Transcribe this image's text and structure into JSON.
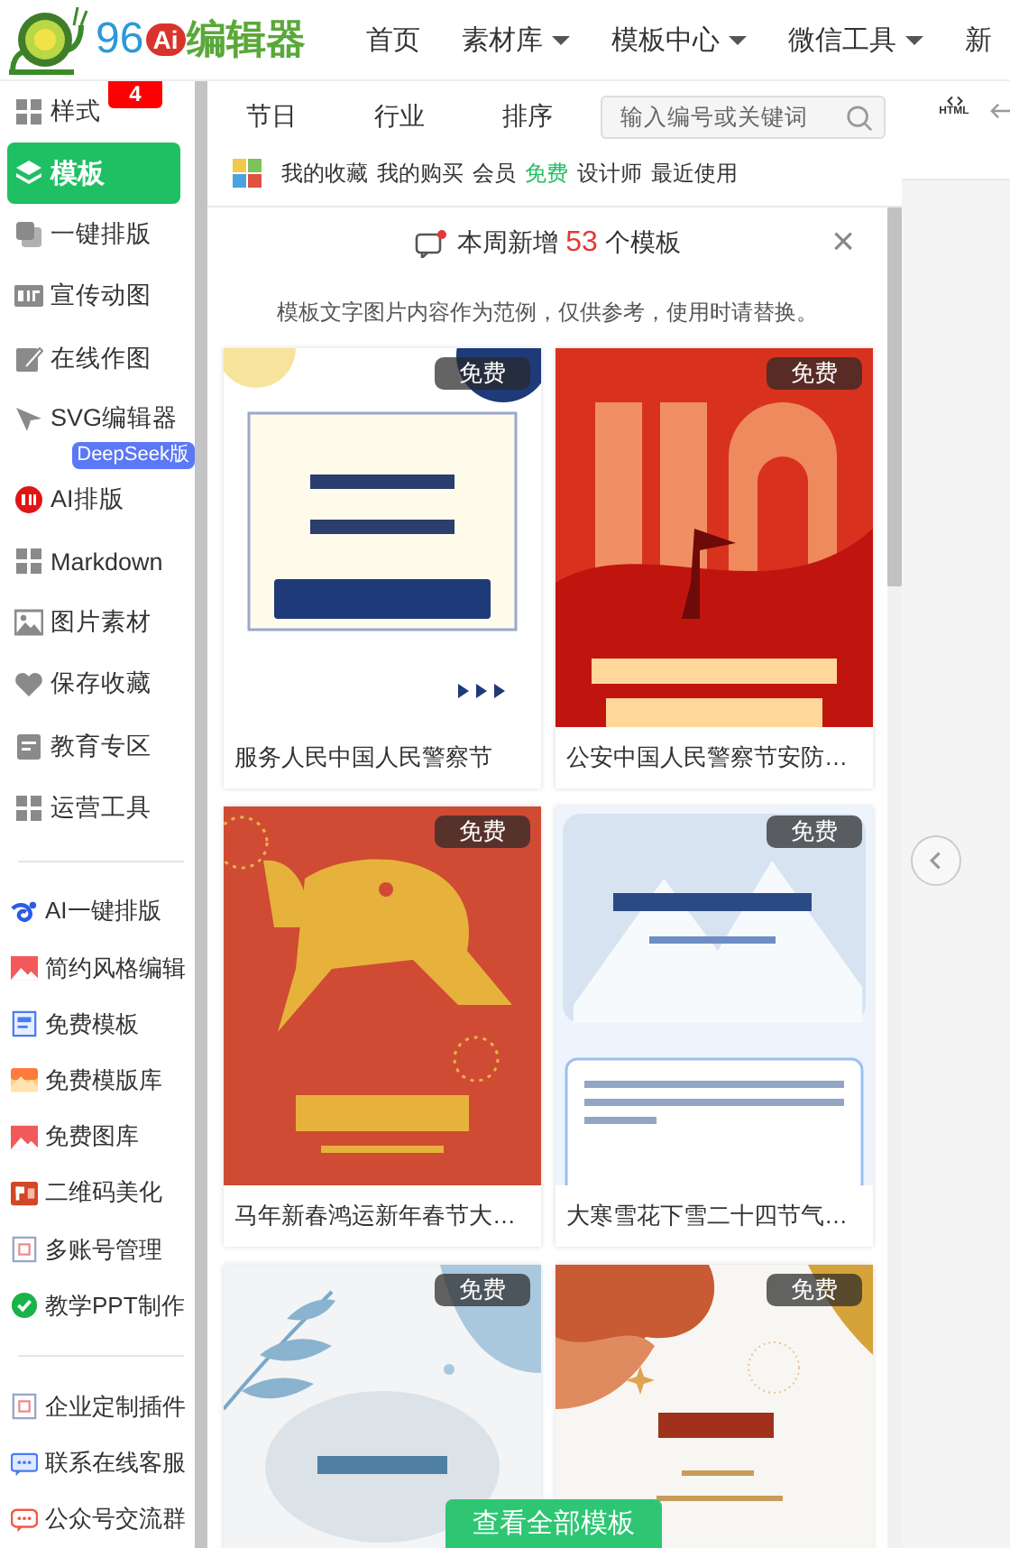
{
  "header": {
    "logo": {
      "number": "96",
      "ai": "Ai",
      "name": "编辑器"
    },
    "nav": [
      {
        "label": "首页",
        "dropdown": false
      },
      {
        "label": "素材库",
        "dropdown": true
      },
      {
        "label": "模板中心",
        "dropdown": true
      },
      {
        "label": "微信工具",
        "dropdown": true
      },
      {
        "label": "新",
        "dropdown": false
      }
    ]
  },
  "sidebar": {
    "sections": [
      {
        "items": [
          {
            "label": "样式",
            "selected": false,
            "badge": "4"
          },
          {
            "label": "模板",
            "selected": true
          },
          {
            "label": "一键排版",
            "selected": false
          },
          {
            "label": "宣传动图",
            "selected": false
          },
          {
            "label": "在线作图",
            "selected": false
          },
          {
            "label": "SVG编辑器",
            "selected": false,
            "tag": "DeepSeek版"
          },
          {
            "label": "AI排版",
            "selected": false
          },
          {
            "label": "Markdown",
            "selected": false
          },
          {
            "label": "图片素材",
            "selected": false
          },
          {
            "label": "保存收藏",
            "selected": false
          },
          {
            "label": "教育专区",
            "selected": false
          },
          {
            "label": "运营工具",
            "selected": false
          }
        ]
      },
      {
        "items": [
          {
            "label": "AI一键排版",
            "selected": false
          },
          {
            "label": "简约风格编辑",
            "selected": false
          },
          {
            "label": "免费模板",
            "selected": false
          },
          {
            "label": "免费模版库",
            "selected": false
          },
          {
            "label": "免费图库",
            "selected": false
          },
          {
            "label": "二维码美化",
            "selected": false
          },
          {
            "label": "多账号管理",
            "selected": false
          },
          {
            "label": "教学PPT制作",
            "selected": false
          }
        ]
      },
      {
        "items": [
          {
            "label": "企业定制插件",
            "selected": false
          },
          {
            "label": "联系在线客服",
            "selected": false
          },
          {
            "label": "公众号交流群",
            "selected": false
          }
        ]
      }
    ]
  },
  "templates": {
    "tabs": [
      {
        "label": "节日"
      },
      {
        "label": "行业"
      },
      {
        "label": "排序"
      }
    ],
    "search": {
      "placeholder": "输入编号或关键词"
    },
    "quick_links": [
      {
        "label": "我的收藏",
        "highlighted": false
      },
      {
        "label": "我的购买",
        "highlighted": false
      },
      {
        "label": "会员",
        "highlighted": false
      },
      {
        "label": "免费",
        "highlighted": true
      },
      {
        "label": "设计师",
        "highlighted": false
      },
      {
        "label": "最近使用",
        "highlighted": false
      }
    ],
    "notice": {
      "prefix": "本周新增",
      "count": "53",
      "suffix": "个模板",
      "close": "×"
    },
    "note": "模板文字图片内容作为范例，仅供参考，使用时请替换。",
    "cards": [
      {
        "badge": "免费",
        "title": "服务人民中国人民警察节",
        "kind": "picture"
      },
      {
        "badge": "免费",
        "title": "公安中国人民警察节安防…",
        "kind": "picture"
      },
      {
        "badge": "免费",
        "title": "马年新春鸿运新年春节大…",
        "kind": "picture"
      },
      {
        "badge": "免费",
        "title": "大寒雪花下雪二十四节气…",
        "kind": "picture"
      },
      {
        "badge": "免费",
        "kind": "picture"
      },
      {
        "badge": "免费",
        "kind": "picture"
      }
    ],
    "view_all_button": "查看全部模板"
  },
  "right_toolbar": {
    "html_label": "HTML"
  }
}
